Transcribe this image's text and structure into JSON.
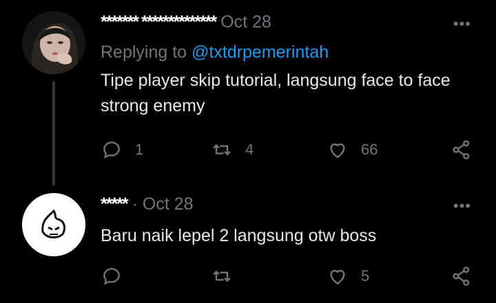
{
  "tweets": [
    {
      "name_censor": "******* **************",
      "emojis": "🌸😺",
      "date": "Oct 28",
      "replying_label": "Replying to",
      "replying_handle": "@txtdrpemerintah",
      "text": "Tipe player skip tutorial, langsung face to face strong enemy",
      "replies": "1",
      "retweets": "4",
      "likes": "66",
      "more": "•••"
    },
    {
      "name_censor": "*****",
      "date": "· Oct 28",
      "text": "Baru naik lepel 2 langsung otw boss",
      "replies": "",
      "retweets": "",
      "likes": "5",
      "more": "•••"
    }
  ],
  "colors": {
    "background": "#000000",
    "text": "#e7e9ea",
    "muted": "#71767b",
    "accent": "#1d9bf0"
  },
  "icons": [
    "reply-icon",
    "retweet-icon",
    "like-icon",
    "share-icon",
    "more-icon",
    "avatar-photo",
    "avatar-logo"
  ]
}
